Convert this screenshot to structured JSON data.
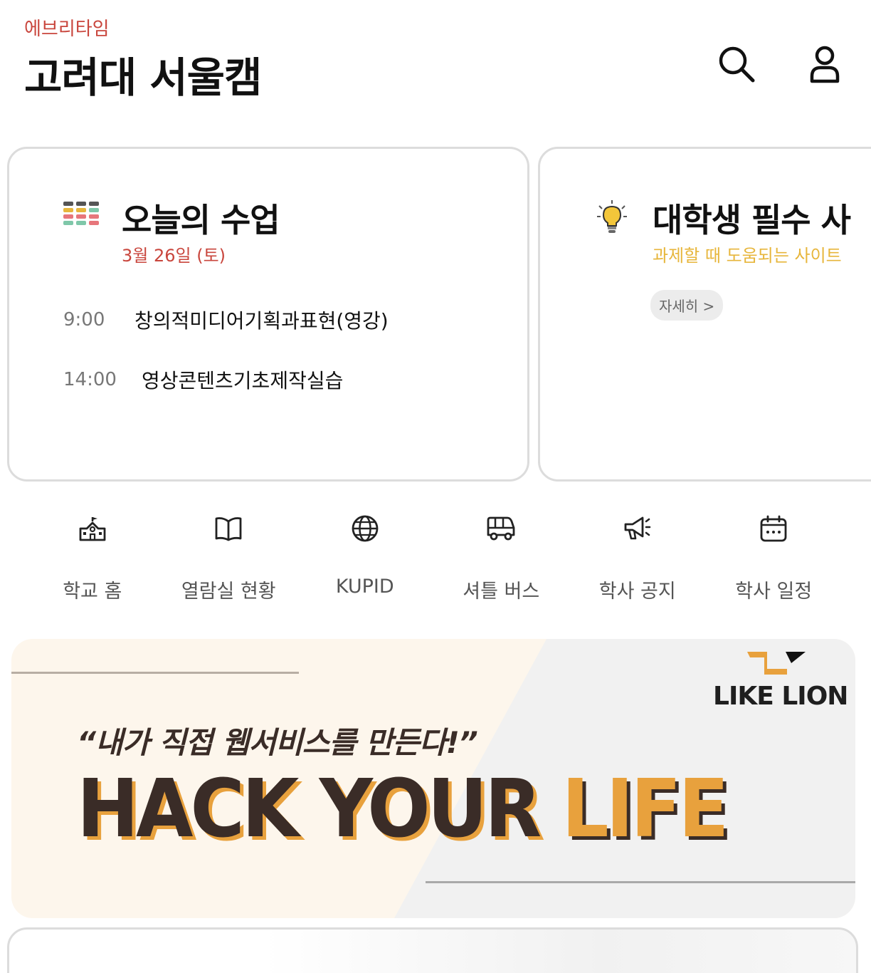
{
  "header": {
    "app_name": "에브리타임",
    "school_name": "고려대 서울캠",
    "search_icon": "search-icon",
    "account_icon": "user-icon"
  },
  "today_card": {
    "icon": "timetable-icon",
    "title": "오늘의 수업",
    "date": "3월 26일 (토)",
    "classes": [
      {
        "time": "9:00",
        "name": "창의적미디어기획과표현(영강)"
      },
      {
        "time": "14:00",
        "name": "영상콘텐츠기초제작실습"
      }
    ],
    "colors": {
      "accent": "#c9463d"
    }
  },
  "tips_card": {
    "icon": "lightbulb-icon",
    "title": "대학생 필수 사",
    "subtitle": "과제할 때 도움되는 사이트 ",
    "more_label": "자세히 >",
    "colors": {
      "accent": "#e7b63c"
    }
  },
  "quick_menu": [
    {
      "icon": "school-icon",
      "label": "학교 홈"
    },
    {
      "icon": "book-icon",
      "label": "열람실 현황"
    },
    {
      "icon": "globe-icon",
      "label": "KUPID"
    },
    {
      "icon": "bus-icon",
      "label": "셔틀 버스"
    },
    {
      "icon": "megaphone-icon",
      "label": "학사 공지"
    },
    {
      "icon": "calendar-icon",
      "label": "학사 일정"
    }
  ],
  "banner": {
    "tagline": "“내가 직접 웹서비스를 만든다!”",
    "headline_dark": "HACK YOUR ",
    "headline_accent": "LIFE",
    "brand": "LIKE LION",
    "colors": {
      "dark": "#3a2c27",
      "accent": "#e8a13d",
      "bg": "#fdf6ec",
      "gray": "#f1f1f1"
    }
  }
}
